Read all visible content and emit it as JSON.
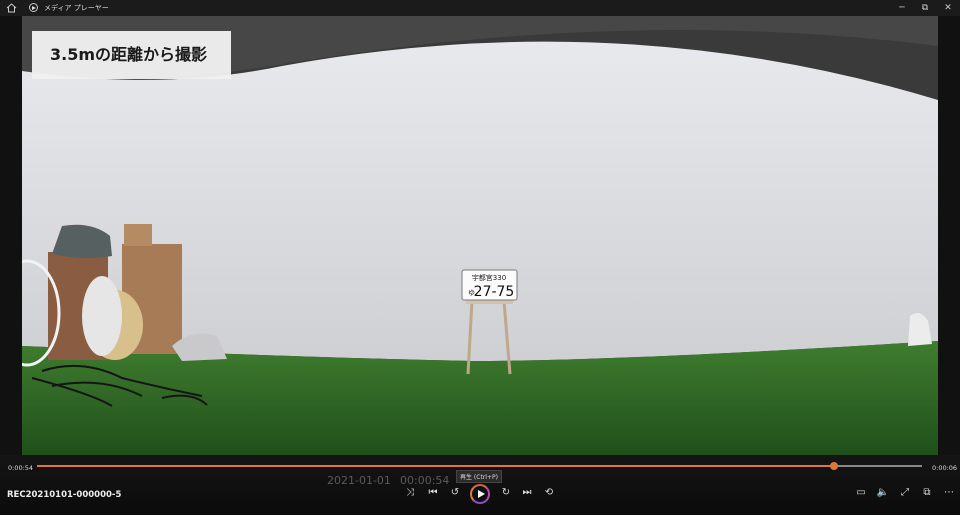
{
  "window": {
    "title": "メディア プレーヤー",
    "minimize_glyph": "─",
    "restore_glyph": "⧉",
    "close_glyph": "✕"
  },
  "video": {
    "caption": "3.5mの距離から撮影",
    "plate_top": "宇都宮330",
    "plate_kana": "ゆ",
    "plate_number": "27-75"
  },
  "player": {
    "elapsed": "0:00:54",
    "remaining": "0:00:06",
    "progress": 0.9,
    "filename": "REC20210101-000000-5",
    "overlay_date": "2021-01-01",
    "overlay_time": "00:00:54",
    "tooltip": "再生 (Ctrl+P)"
  },
  "colors": {
    "accent": "#e0773a",
    "grass": "#2f6b25",
    "wall": "#d6d7da"
  },
  "icons": [
    "home-icon",
    "media-player-icon",
    "minimize-icon",
    "restore-icon",
    "close-icon",
    "shuffle-icon",
    "previous-icon",
    "rewind-icon",
    "play-icon",
    "fast-forward-icon",
    "next-icon",
    "repeat-off-icon",
    "miniplayer-icon",
    "volume-icon",
    "fullscreen-icon",
    "cast-icon",
    "more-icon"
  ]
}
